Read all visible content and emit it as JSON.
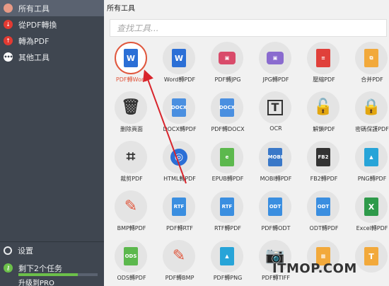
{
  "sidebar": {
    "items": [
      {
        "label": "所有工具",
        "icon": "all-tools-icon"
      },
      {
        "label": "從PDF轉換",
        "icon": "download-icon"
      },
      {
        "label": "轉為PDF",
        "icon": "upload-icon"
      },
      {
        "label": "其他工具",
        "icon": "more-icon"
      }
    ],
    "settings_label": "设置",
    "tasks_label": "剩下2个任务",
    "tasks_progress": 0.75,
    "upgrade_label": "升级到PRO"
  },
  "main": {
    "title": "所有工具",
    "search_placeholder": "查找工具..."
  },
  "tools": [
    {
      "label": "PDF轉Word",
      "icon": "word-icon",
      "color": "#2b6fd6",
      "selected": true
    },
    {
      "label": "Word轉PDF",
      "icon": "word-icon",
      "color": "#2b6fd6"
    },
    {
      "label": "PDF轉JPG",
      "icon": "jpg-icon",
      "color": "#d94b6a"
    },
    {
      "label": "JPG轉PDF",
      "icon": "jpg-icon",
      "color": "#8a6bcf"
    },
    {
      "label": "壓縮PDF",
      "icon": "compress-icon",
      "color": "#e0403a"
    },
    {
      "label": "合并PDF",
      "icon": "merge-icon",
      "color": "#f2a93b"
    },
    {
      "label": "删除頁面",
      "icon": "trash-icon",
      "color": "#333333"
    },
    {
      "label": "DOCX轉PDF",
      "icon": "docx-icon",
      "color": "#4a8fe0"
    },
    {
      "label": "PDF轉DOCX",
      "icon": "docx-icon",
      "color": "#4a8fe0"
    },
    {
      "label": "OCR",
      "icon": "ocr-icon",
      "color": "#333333"
    },
    {
      "label": "解鎖PDF",
      "icon": "unlock-icon",
      "color": "#333333"
    },
    {
      "label": "密碼保護PDF",
      "icon": "lock-icon",
      "color": "#333333"
    },
    {
      "label": "裁剪PDF",
      "icon": "crop-icon",
      "color": "#333333"
    },
    {
      "label": "HTML轉PDF",
      "icon": "globe-icon",
      "color": "#2b6fd6"
    },
    {
      "label": "EPUB轉PDF",
      "icon": "epub-icon",
      "color": "#5cb84d"
    },
    {
      "label": "MOBI轉PDF",
      "icon": "mobi-icon",
      "color": "#3a78c8"
    },
    {
      "label": "FB2轉PDF",
      "icon": "fb2-icon",
      "color": "#333333"
    },
    {
      "label": "PNG轉PDF",
      "icon": "png-icon",
      "color": "#27a4d8"
    },
    {
      "label": "BMP轉PDF",
      "icon": "brush-icon",
      "color": "#e0573d"
    },
    {
      "label": "PDF轉RTF",
      "icon": "rtf-icon",
      "color": "#3a8ee0"
    },
    {
      "label": "RTF轉PDF",
      "icon": "rtf-icon",
      "color": "#3a8ee0"
    },
    {
      "label": "PDF轉ODT",
      "icon": "odt-icon",
      "color": "#3a8ee0"
    },
    {
      "label": "ODT轉PDF",
      "icon": "odt-icon",
      "color": "#3a8ee0"
    },
    {
      "label": "Excel轉PDF",
      "icon": "excel-icon",
      "color": "#2e9a4a"
    },
    {
      "label": "ODS轉PDF",
      "icon": "ods-icon",
      "color": "#5cb84d"
    },
    {
      "label": "PDF轉BMP",
      "icon": "brush-icon",
      "color": "#e0573d"
    },
    {
      "label": "PDF轉PNG",
      "icon": "png-icon",
      "color": "#27a4d8"
    },
    {
      "label": "PDF轉TIFF",
      "icon": "camera-icon",
      "color": "#333333"
    },
    {
      "label": "",
      "icon": "picture-icon",
      "color": "#f2a93b"
    },
    {
      "label": "",
      "icon": "text-icon",
      "color": "#f2a93b"
    }
  ],
  "watermark": "ITMOP.COM"
}
